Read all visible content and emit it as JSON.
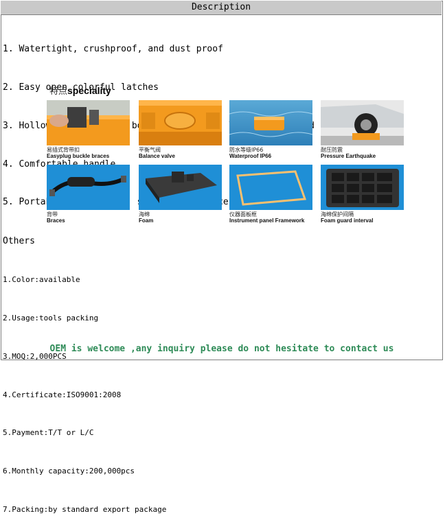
{
  "header": {
    "title": "Description"
  },
  "features": [
    "1. Watertight, crushproof, and dust proof",
    "2. Easy open colorful latches",
    "3. Hollow  blow molding boxes are strong, light weight,and shockproof",
    "4. Comfortable handle",
    "5. Portable ,waterproof, strong resistance,Eco-Friendly"
  ],
  "speciality": {
    "title_cn": "特点",
    "title_en": "speciality",
    "items": [
      {
        "cn": "易插式背带扣",
        "en": "Easyplug buckle braces",
        "icon": "buckle-photo"
      },
      {
        "cn": "平衡气阀",
        "en": "Balance valve",
        "icon": "valve-photo"
      },
      {
        "cn": "防水等级IP66",
        "en": "Waterproof IP66",
        "icon": "waterproof-photo"
      },
      {
        "cn": "耐压防震",
        "en": "Pressure Earthquake",
        "icon": "car-pressure-photo"
      },
      {
        "cn": "背带",
        "en": "Braces",
        "icon": "strap-photo"
      },
      {
        "cn": "海绵",
        "en": "Foam",
        "icon": "foam-photo"
      },
      {
        "cn": "仪器面板框",
        "en": "Instrument panel Framework",
        "icon": "frame-photo"
      },
      {
        "cn": "海绵保护间隔",
        "en": "Foam guard interval",
        "icon": "foam-grid-photo"
      }
    ]
  },
  "others": {
    "heading": "Others",
    "items": [
      "1.Color:available",
      "2.Usage:tools packing",
      "3.MOQ:2,000PCS",
      "4.Certificate:ISO9001:2008",
      "5.Payment:T/T or L/C",
      "6.Monthly capacity:200,000pcs",
      "7.Packing:by standard export package"
    ]
  },
  "footer": {
    "text": "OEM is welcome ,any inquiry please do not hesitate to contact us"
  },
  "colors": {
    "header_bg": "#c9c9c9",
    "footer_text": "#2e8b57",
    "case_orange": "#f39a1e",
    "photo_blue": "#1f8fd6"
  }
}
